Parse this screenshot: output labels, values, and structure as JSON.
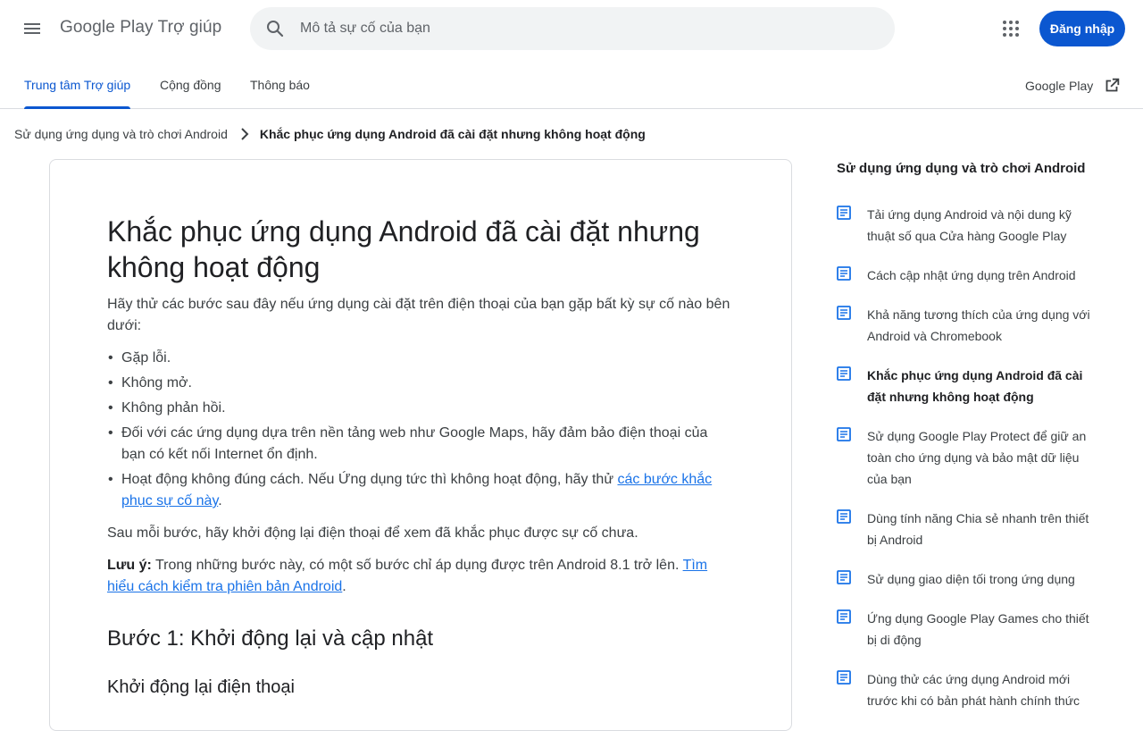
{
  "header": {
    "app_title": "Google Play Trợ giúp",
    "search_placeholder": "Mô tả sự cố của bạn",
    "signin_label": "Đăng nhập"
  },
  "tabs": [
    {
      "label": "Trung tâm Trợ giúp",
      "active": true
    },
    {
      "label": "Cộng đồng",
      "active": false
    },
    {
      "label": "Thông báo",
      "active": false
    }
  ],
  "external_link": "Google Play",
  "breadcrumb": {
    "parent": "Sử dụng ứng dụng và trò chơi Android",
    "current": "Khắc phục ứng dụng Android đã cài đặt nhưng không hoạt động"
  },
  "article": {
    "title": "Khắc phục ứng dụng Android đã cài đặt nhưng không hoạt động",
    "intro": "Hãy thử các bước sau đây nếu ứng dụng cài đặt trên điện thoại của bạn gặp bất kỳ sự cố nào bên dưới:",
    "bullets": [
      "Gặp lỗi.",
      "Không mở.",
      "Không phản hồi.",
      "Đối với các ứng dụng dựa trên nền tảng web như Google Maps, hãy đảm bảo điện thoại của bạn có kết nối Internet ổn định."
    ],
    "bullet5_text": "Hoạt động không đúng cách. Nếu Ứng dụng tức thì không hoạt động, hãy thử ",
    "bullet5_link": "các bước khắc phục sự cố này",
    "bullet5_end": ".",
    "after_each": "Sau mỗi bước, hãy khởi động lại điện thoại để xem đã khắc phục được sự cố chưa.",
    "note_label": "Lưu ý:",
    "note_text": " Trong những bước này, có một số bước chỉ áp dụng được trên Android 8.1 trở lên. ",
    "note_link": "Tìm hiểu cách kiểm tra phiên bản Android",
    "note_end": ".",
    "step1_heading": "Bước 1: Khởi động lại và cập nhật",
    "step1_sub": "Khởi động lại điện thoại"
  },
  "sidebar": {
    "title": "Sử dụng ứng dụng và trò chơi Android",
    "items": [
      {
        "label": "Tải ứng dụng Android và nội dung kỹ thuật số qua Cửa hàng Google Play",
        "current": false
      },
      {
        "label": "Cách cập nhật ứng dụng trên Android",
        "current": false
      },
      {
        "label": "Khả năng tương thích của ứng dụng với Android và Chromebook",
        "current": false
      },
      {
        "label": "Khắc phục ứng dụng Android đã cài đặt nhưng không hoạt động",
        "current": true
      },
      {
        "label": "Sử dụng Google Play Protect để giữ an toàn cho ứng dụng và bảo mật dữ liệu của bạn",
        "current": false
      },
      {
        "label": "Dùng tính năng Chia sẻ nhanh trên thiết bị Android",
        "current": false
      },
      {
        "label": "Sử dụng giao diện tối trong ứng dụng",
        "current": false
      },
      {
        "label": "Ứng dụng Google Play Games cho thiết bị di động",
        "current": false
      },
      {
        "label": "Dùng thử các ứng dụng Android mới trước khi có bản phát hành chính thức",
        "current": false
      }
    ]
  },
  "colors": {
    "accent": "#0b57d0",
    "link": "#1a73e8",
    "search_bg": "#f1f3f4",
    "divider": "#dadce0"
  }
}
